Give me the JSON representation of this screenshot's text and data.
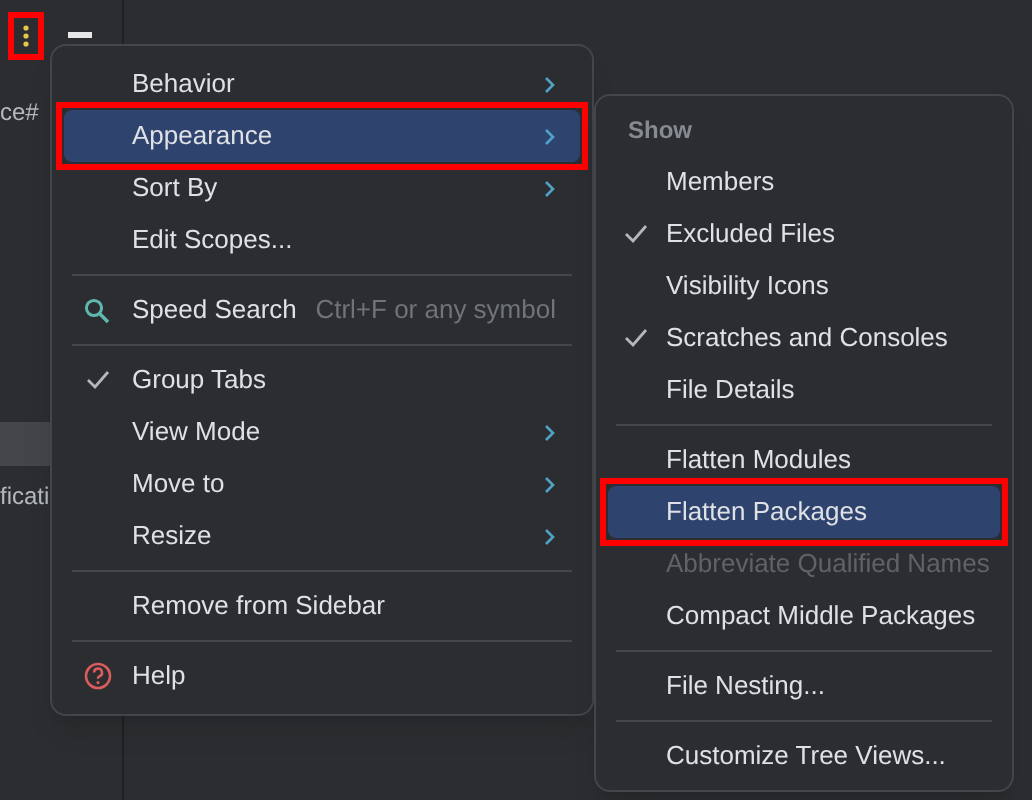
{
  "sidebar": {
    "fragments": [
      {
        "text": "ce#"
      },
      {
        "text": "ficati"
      }
    ]
  },
  "menu": {
    "items": [
      {
        "kind": "item",
        "label": "Behavior",
        "submenu": true,
        "selected": false
      },
      {
        "kind": "item",
        "label": "Appearance",
        "submenu": true,
        "selected": true,
        "highlighted": true
      },
      {
        "kind": "item",
        "label": "Sort By",
        "submenu": true,
        "selected": false
      },
      {
        "kind": "item",
        "label": "Edit Scopes...",
        "selected": false
      },
      {
        "kind": "separator"
      },
      {
        "kind": "search",
        "label": "Speed Search",
        "shortcut": "Ctrl+F or any symbol",
        "selected": false
      },
      {
        "kind": "separator"
      },
      {
        "kind": "item",
        "label": "Group Tabs",
        "checked": true,
        "selected": false
      },
      {
        "kind": "item",
        "label": "View Mode",
        "submenu": true,
        "selected": false
      },
      {
        "kind": "item",
        "label": "Move to",
        "submenu": true,
        "selected": false
      },
      {
        "kind": "item",
        "label": "Resize",
        "submenu": true,
        "selected": false
      },
      {
        "kind": "separator"
      },
      {
        "kind": "item",
        "label": "Remove from Sidebar",
        "selected": false
      },
      {
        "kind": "separator"
      },
      {
        "kind": "help",
        "label": "Help",
        "selected": false
      }
    ]
  },
  "submenu": {
    "items": [
      {
        "kind": "header",
        "label": "Show"
      },
      {
        "kind": "item",
        "label": "Members",
        "checked": false,
        "selected": false
      },
      {
        "kind": "item",
        "label": "Excluded Files",
        "checked": true,
        "selected": false
      },
      {
        "kind": "item",
        "label": "Visibility Icons",
        "checked": false,
        "selected": false
      },
      {
        "kind": "item",
        "label": "Scratches and Consoles",
        "checked": true,
        "selected": false
      },
      {
        "kind": "item",
        "label": "File Details",
        "checked": false,
        "selected": false
      },
      {
        "kind": "separator"
      },
      {
        "kind": "item",
        "label": "Flatten Modules",
        "checked": false,
        "selected": false
      },
      {
        "kind": "item",
        "label": "Flatten Packages",
        "checked": false,
        "selected": true,
        "highlighted": true
      },
      {
        "kind": "item",
        "label": "Abbreviate Qualified Names",
        "checked": false,
        "selected": false,
        "disabled": true
      },
      {
        "kind": "item",
        "label": "Compact Middle Packages",
        "checked": false,
        "selected": false
      },
      {
        "kind": "separator"
      },
      {
        "kind": "item",
        "label": "File Nesting...",
        "checked": false,
        "selected": false
      },
      {
        "kind": "separator"
      },
      {
        "kind": "item",
        "label": "Customize Tree Views...",
        "checked": false,
        "selected": false
      }
    ]
  }
}
